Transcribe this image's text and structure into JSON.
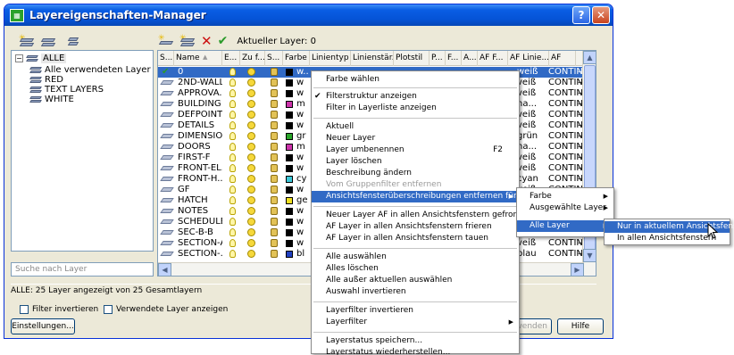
{
  "window": {
    "title": "Layereigenschaften-Manager",
    "help_glyph": "?",
    "close_glyph": "✕",
    "title_icon_glyph": "▦"
  },
  "toolbar": {
    "current_layer_label": "Aktueller Layer: 0",
    "delete_glyph": "✕",
    "set_current_glyph": "✔"
  },
  "tree": {
    "root_label": "ALLE",
    "collapse_glyph": "⊟",
    "items": [
      "Alle verwendeten Layer",
      "RED",
      "TEXT LAYERS",
      "WHITE"
    ],
    "search_placeholder": "Suche nach Layer"
  },
  "columns": [
    "S...",
    "Name",
    "▲",
    "E...",
    "Zu f...",
    "S...",
    "Farbe",
    "Linientyp",
    "Linienstär...",
    "Plotstil",
    "P...",
    "F...",
    "A...",
    "AF F...",
    "AF Linie...",
    "AF"
  ],
  "rows": [
    {
      "name": "0",
      "color": "w...",
      "swatch": "#000000",
      "af_color": "weiß",
      "af_linetype": "CONTIN...",
      "current": true
    },
    {
      "name": "2ND-WALL",
      "color": "w",
      "swatch": "#000000",
      "af_color": "veiß",
      "af_linetype": "CONTIN..."
    },
    {
      "name": "APPROVA...",
      "color": "w",
      "swatch": "#000000",
      "af_color": "veiß",
      "af_linetype": "CONTIN..."
    },
    {
      "name": "BUILDING",
      "color": "m",
      "swatch": "#cc33aa",
      "af_color": "na...",
      "af_linetype": "CONTIN..."
    },
    {
      "name": "DEFPOINTS",
      "color": "w",
      "swatch": "#000000",
      "af_color": "veiß",
      "af_linetype": "CONTIN..."
    },
    {
      "name": "DETAILS",
      "color": "w",
      "swatch": "#000000",
      "af_color": "veiß",
      "af_linetype": "CONTIN..."
    },
    {
      "name": "DIMENSIO...",
      "color": "gr",
      "swatch": "#2aa52a",
      "af_color": "grün",
      "af_linetype": "CONTIN..."
    },
    {
      "name": "DOORS",
      "color": "m",
      "swatch": "#cc33aa",
      "af_color": "na...",
      "af_linetype": "CONTIN..."
    },
    {
      "name": "FIRST-F",
      "color": "w",
      "swatch": "#000000",
      "af_color": "veiß",
      "af_linetype": "CONTIN..."
    },
    {
      "name": "FRONT-EL...",
      "color": "w",
      "swatch": "#000000",
      "af_color": "veiß",
      "af_linetype": "CONTIN..."
    },
    {
      "name": "FRONT-H...",
      "color": "cy",
      "swatch": "#3cc8d8",
      "af_color": "cyan",
      "af_linetype": "CONTIN..."
    },
    {
      "name": "GF",
      "color": "w",
      "swatch": "#000000",
      "af_color": "veiß",
      "af_linetype": "CONTIN..."
    },
    {
      "name": "HATCH",
      "color": "ge",
      "swatch": "#f0e020",
      "af_color": "",
      "af_linetype": ""
    },
    {
      "name": "NOTES",
      "color": "w",
      "swatch": "#000000",
      "af_color": "",
      "af_linetype": ""
    },
    {
      "name": "SCHEDULE",
      "color": "w",
      "swatch": "#000000",
      "af_color": "",
      "af_linetype": ""
    },
    {
      "name": "SEC-B-B",
      "color": "w",
      "swatch": "#000000",
      "af_color": "veiß",
      "af_linetype": "CONTIN..."
    },
    {
      "name": "SECTION-A",
      "color": "w",
      "swatch": "#000000",
      "af_color": "veiß",
      "af_linetype": "CONTIN..."
    },
    {
      "name": "SECTION-...",
      "color": "bl",
      "swatch": "#2040c0",
      "af_color": "blau",
      "af_linetype": "CONTIN..."
    }
  ],
  "status": {
    "text": "ALLE: 25 Layer angezeigt von 25 Gesamtlayern"
  },
  "options": {
    "invert_filter": "Filter invertieren",
    "show_used": "Verwendete Layer anzeigen"
  },
  "buttons": {
    "settings": "Einstellungen...",
    "apply_partial": "venden",
    "help": "Hilfe"
  },
  "context_menu": {
    "items": [
      {
        "label": "Farbe wählen"
      },
      {
        "label": "Filterstruktur anzeigen",
        "checked": true
      },
      {
        "label": "Filter in Layerliste anzeigen"
      },
      {
        "label": "Aktuell"
      },
      {
        "label": "Neuer Layer"
      },
      {
        "label": "Layer umbenennen",
        "accel": "F2"
      },
      {
        "label": "Layer löschen"
      },
      {
        "label": "Beschreibung ändern"
      },
      {
        "label": "Vom Gruppenfilter entfernen",
        "disabled": true
      },
      {
        "label": "Ansichtsfensterüberschreibungen entfernen für",
        "submenu": true,
        "highlight": true
      },
      {
        "label": "Neuer Layer AF in allen Ansichtsfenstern gefroren"
      },
      {
        "label": "AF Layer in allen Ansichtsfenstern frieren"
      },
      {
        "label": "AF Layer in allen Ansichtsfenstern tauen"
      },
      {
        "label": "Alle auswählen"
      },
      {
        "label": "Alles löschen"
      },
      {
        "label": "Alle außer aktuellen auswählen"
      },
      {
        "label": "Auswahl invertieren"
      },
      {
        "label": "Layerfilter invertieren"
      },
      {
        "label": "Layerfilter",
        "submenu": true
      },
      {
        "label": "Layerstatus speichern..."
      },
      {
        "label": "Layerstatus wiederherstellen..."
      }
    ],
    "check_glyph": "✔",
    "arrow_glyph": "▶"
  },
  "submenu1": {
    "items": [
      "Farbe",
      "Ausgewählte Layer",
      "Alle Layer"
    ]
  },
  "submenu2": {
    "items": [
      "Nur in aktuellem Ansichtsfenster",
      "In allen Ansichtsfenstern"
    ]
  },
  "scroll": {
    "up": "▲",
    "down": "▼",
    "right": "▶",
    "left": "◀"
  }
}
